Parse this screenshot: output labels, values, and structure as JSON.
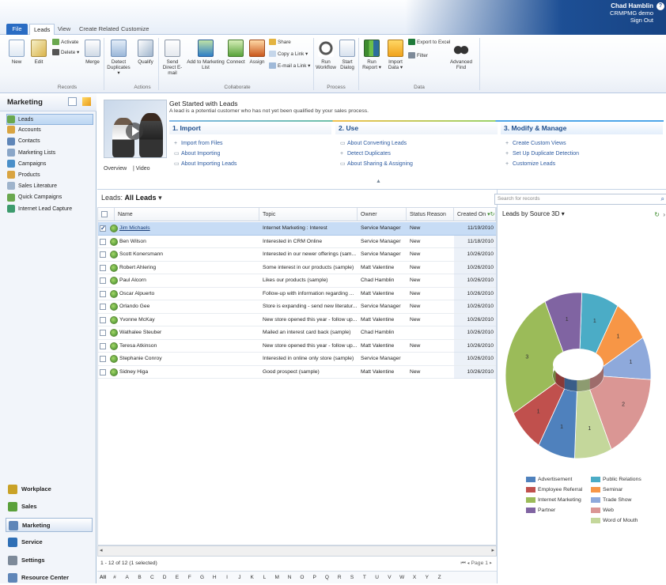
{
  "tabs": {
    "file": "File",
    "leads": "Leads",
    "view": "View",
    "create_related": "Create Related",
    "customize": "Customize"
  },
  "user": {
    "name": "Chad Hamblin",
    "org": "CRMPMG demo",
    "sign_out": "Sign Out"
  },
  "ribbon": {
    "new": "New",
    "edit": "Edit",
    "activate": "Activate",
    "delete": "Delete",
    "merge": "Merge",
    "detect": "Detect Duplicates",
    "qualify": "Qualify",
    "send_email": "Send Direct E-mail",
    "add_list": "Add to Marketing List",
    "connect": "Connect",
    "assign": "Assign",
    "share": "Share",
    "copy_link": "Copy a Link",
    "email_link": "E-mail a Link",
    "run_workflow": "Run Workflow",
    "start_dialog": "Start Dialog",
    "run_report": "Run Report",
    "import_data": "Import Data",
    "export": "Export to Excel",
    "filter": "Filter",
    "adv_find": "Advanced Find",
    "groups": {
      "records": "Records",
      "actions": "Actions",
      "collaborate": "Collaborate",
      "process": "Process",
      "data": "Data"
    }
  },
  "nav": {
    "title": "Marketing",
    "items": [
      "Leads",
      "Accounts",
      "Contacts",
      "Marketing Lists",
      "Campaigns",
      "Products",
      "Sales Literature",
      "Quick Campaigns",
      "Internet Lead Capture"
    ],
    "areas": [
      "Workplace",
      "Sales",
      "Marketing",
      "Service",
      "Settings",
      "Resource Center"
    ]
  },
  "get_started": {
    "title": "Get Started with Leads",
    "subtitle": "A lead is a potential customer who has not yet been qualified by your sales process.",
    "video_overview": "Overview",
    "video_label": "| Video",
    "col1": {
      "head": "1. Import",
      "links": [
        "Import from Files",
        "About Importing",
        "About Importing Leads"
      ]
    },
    "col2": {
      "head": "2. Use",
      "links": [
        "About Converting Leads",
        "Detect Duplicates",
        "About Sharing & Assigning"
      ]
    },
    "col3": {
      "head": "3. Modify & Manage",
      "links": [
        "Create Custom Views",
        "Set Up Duplicate Detection",
        "Customize Leads"
      ]
    }
  },
  "view": {
    "label": "Leads:",
    "name": "All Leads"
  },
  "grid": {
    "columns": [
      "Name",
      "Topic",
      "Owner",
      "Status Reason",
      "Created On"
    ],
    "rows": [
      {
        "name": "Jim Michaels",
        "topic": "Internet Marketing : Interest",
        "owner": "Service Manager",
        "status": "New",
        "date": "11/19/2010"
      },
      {
        "name": "Ben Wilson",
        "topic": "Interested in CRM Online",
        "owner": "Service Manager",
        "status": "New",
        "date": "11/18/2010"
      },
      {
        "name": "Scott Konersmann",
        "topic": "Interested in our newer offerings (sam...",
        "owner": "Service Manager",
        "status": "New",
        "date": "10/26/2010"
      },
      {
        "name": "Robert Ahlering",
        "topic": "Some interest in our products (sample)",
        "owner": "Matt Valentine",
        "status": "New",
        "date": "10/26/2010"
      },
      {
        "name": "Paul Alcorn",
        "topic": "Likes our products (sample)",
        "owner": "Chad Hamblin",
        "status": "New",
        "date": "10/26/2010"
      },
      {
        "name": "Oscar Alpuerto",
        "topic": "Follow-up with information regarding ...",
        "owner": "Matt Valentine",
        "status": "New",
        "date": "10/26/2010"
      },
      {
        "name": "Orlando Gee",
        "topic": "Store is expanding - send new literatur...",
        "owner": "Service Manager",
        "status": "New",
        "date": "10/26/2010"
      },
      {
        "name": "Yvonne McKay",
        "topic": "New store opened this year - follow up...",
        "owner": "Matt Valentine",
        "status": "New",
        "date": "10/26/2010"
      },
      {
        "name": "Wathalee Steuber",
        "topic": "Mailed an interest card back (sample)",
        "owner": "Chad Hamblin",
        "status": "",
        "date": "10/26/2010"
      },
      {
        "name": "Teresa Atkinson",
        "topic": "New store opened this year - follow up...",
        "owner": "Matt Valentine",
        "status": "New",
        "date": "10/26/2010"
      },
      {
        "name": "Stephanie Conroy",
        "topic": "Interested in online only store (sample)",
        "owner": "Service Manager",
        "status": "",
        "date": "10/26/2010"
      },
      {
        "name": "Sidney Higa",
        "topic": "Good prospect (sample)",
        "owner": "Matt Valentine",
        "status": "New",
        "date": "10/26/2010"
      }
    ]
  },
  "status": {
    "count": "1 - 12 of 12 (1 selected)",
    "page": "Page 1"
  },
  "alphabet": [
    "All",
    "#",
    "A",
    "B",
    "C",
    "D",
    "E",
    "F",
    "G",
    "H",
    "I",
    "J",
    "K",
    "L",
    "M",
    "N",
    "O",
    "P",
    "Q",
    "R",
    "S",
    "T",
    "U",
    "V",
    "W",
    "X",
    "Y",
    "Z"
  ],
  "search": {
    "placeholder": "Search for records"
  },
  "chart_data": {
    "type": "pie",
    "title": "Leads by Source 3D",
    "slices": [
      {
        "name": "Public Relations",
        "value": 1,
        "color": "#4bacc6"
      },
      {
        "name": "Seminar",
        "value": 1,
        "color": "#f79646"
      },
      {
        "name": "Trade Show",
        "value": 1,
        "color": "#8ea9db"
      },
      {
        "name": "Web",
        "value": 2,
        "color": "#da9694"
      },
      {
        "name": "Word of Mouth",
        "value": 1,
        "color": "#c4d79b"
      },
      {
        "name": "Advertisement",
        "value": 1,
        "color": "#4f81bd"
      },
      {
        "name": "Employee Referral",
        "value": 1,
        "color": "#c0504d"
      },
      {
        "name": "Internet Marketing",
        "value": 3,
        "color": "#9bbb59"
      },
      {
        "name": "Partner",
        "value": 1,
        "color": "#8064a2"
      }
    ],
    "legend_order": [
      "Advertisement",
      "Public Relations",
      "Employee Referral",
      "Seminar",
      "Internet Marketing",
      "Trade Show",
      "Partner",
      "Web",
      "Word of Mouth"
    ]
  }
}
